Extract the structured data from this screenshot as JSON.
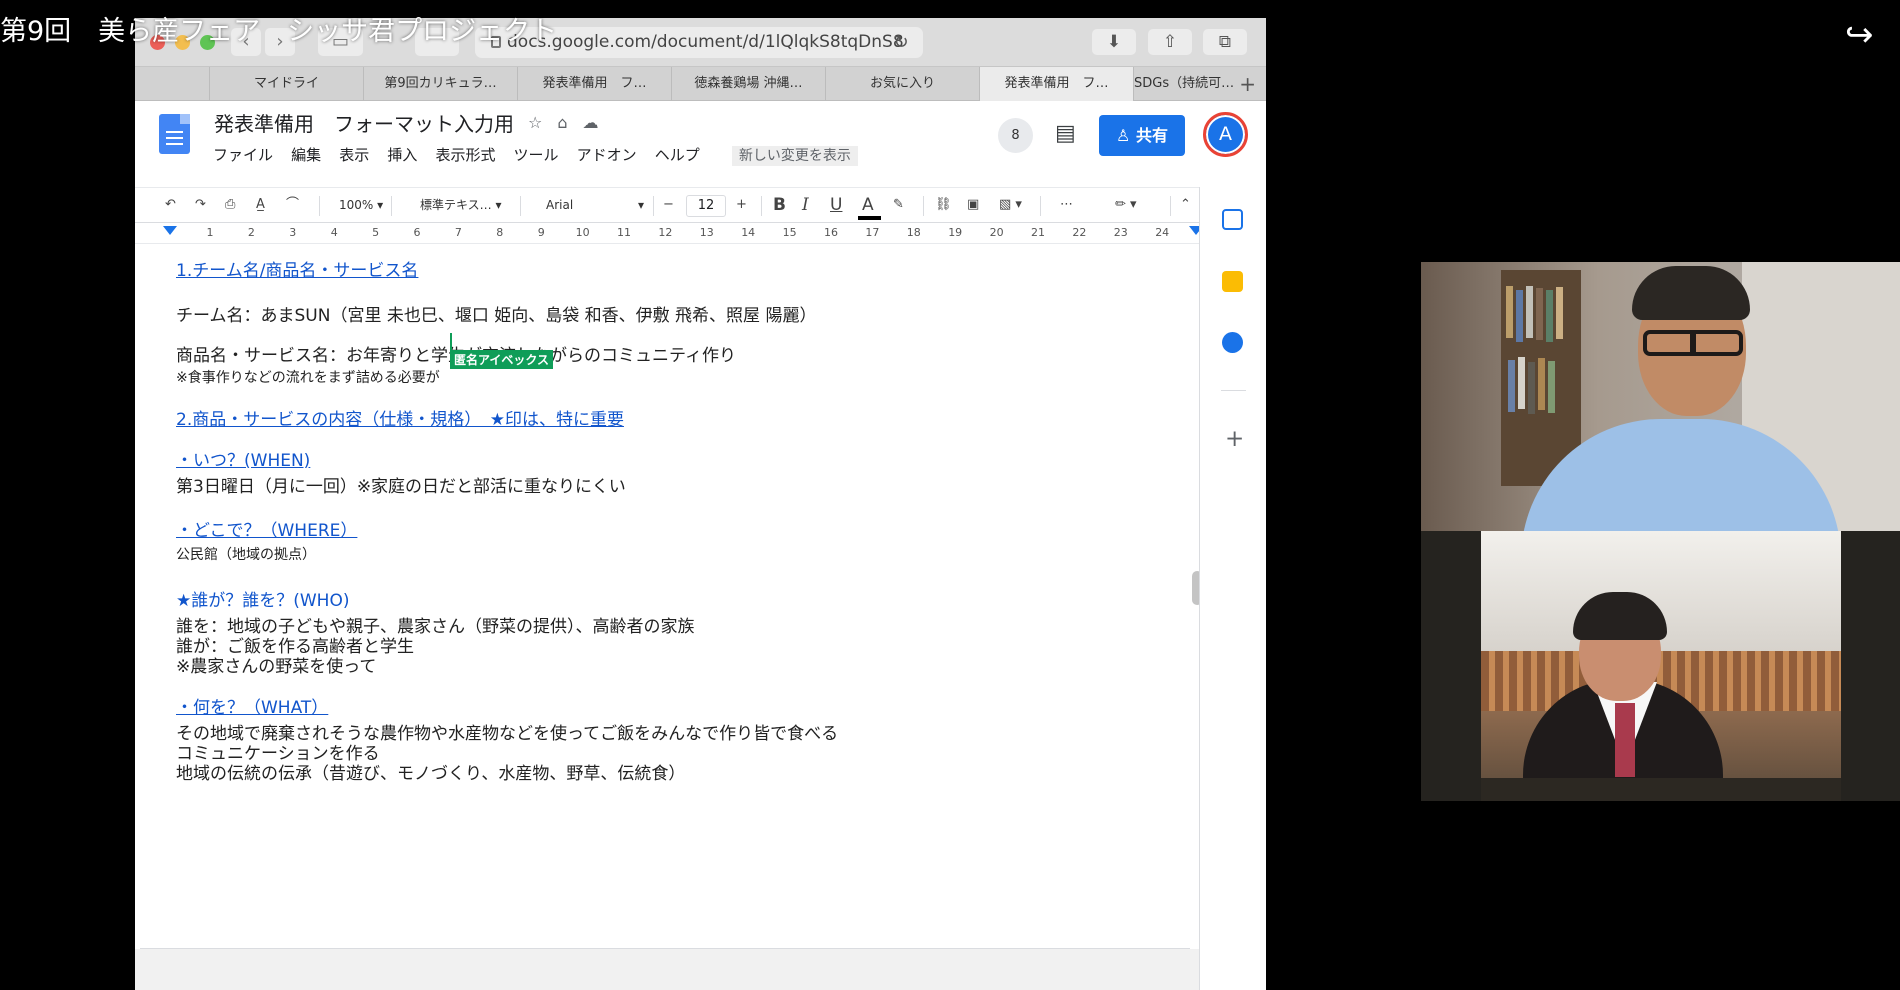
{
  "video": {
    "title": "第9回　美ら産フェア　シッサ君プロジェクト",
    "share_icon": "share-arrow-icon"
  },
  "browser": {
    "address": "docs.google.com/document/d/1lQlqkS8tqDnS8",
    "tabs": [
      "マイドライ",
      "第9回カリキュラ…",
      "発表準備用　フ…",
      "徳森養鶏場 沖縄…",
      "お気に入り",
      "発表準備用　フ…",
      "SDGs（持続可…"
    ],
    "active_tab_index": 5
  },
  "docs": {
    "title": "発表準備用　フォーマット入力用",
    "menus": [
      "ファイル",
      "編集",
      "表示",
      "挿入",
      "表示形式",
      "ツール",
      "アドオン",
      "ヘルプ"
    ],
    "new_changes": "新しい変更を表示",
    "viewers_count": "8",
    "share_label": "共有",
    "avatar_letter": "A",
    "toolbar": {
      "zoom": "100%",
      "style": "標準テキス…",
      "font": "Arial",
      "font_size": "12",
      "bold": "B",
      "italic": "I",
      "underline": "U",
      "text_color": "A"
    },
    "ruler_numbers": [
      "1",
      "2",
      "3",
      "4",
      "5",
      "6",
      "7",
      "8",
      "9",
      "10",
      "11",
      "12",
      "13",
      "14",
      "15",
      "16",
      "17",
      "18",
      "19",
      "20",
      "21",
      "22",
      "23",
      "24"
    ],
    "cursor_label": "匿名アイベックス",
    "content": {
      "h1": "1.チーム名/商品名・サービス名",
      "team": "チーム名：あまSUN（宮里 未也巳、堰口 姫向、島袋 和香、伊敷 飛希、照屋 陽麗）",
      "product": "商品名・サービス名：お年寄りと学生が交流しながらのコミュニティ作り",
      "note1": "※食事作りなどの流れをまず詰める必要が",
      "h2": "2.商品・サービスの内容（仕様・規格）　★印は、特に重要",
      "when_heading": "・いつ？(WHEN)",
      "when_text": "第3日曜日（月に一回）※家庭の日だと部活に重なりにくい",
      "where_heading": "・どこで？（WHERE）",
      "where_text": "公民館（地域の拠点）",
      "who_heading": "★誰が？誰を？(WHO)",
      "who_text1": "誰を：地域の子どもや親子、農家さん（野菜の提供）、高齢者の家族",
      "who_text2": "誰が：ご飯を作る高齢者と学生",
      "who_text3": "※農家さんの野菜を使って",
      "what_heading": "・何を？（WHAT）",
      "what_text1": "その地域で廃棄されそうな農作物や水産物などを使ってご飯をみんなで作り皆で食べる",
      "what_text2": "コミュニケーションを作る",
      "what_text3": "地域の伝統の伝承（昔遊び、モノづくり、水産物、野草、伝統食）"
    }
  }
}
